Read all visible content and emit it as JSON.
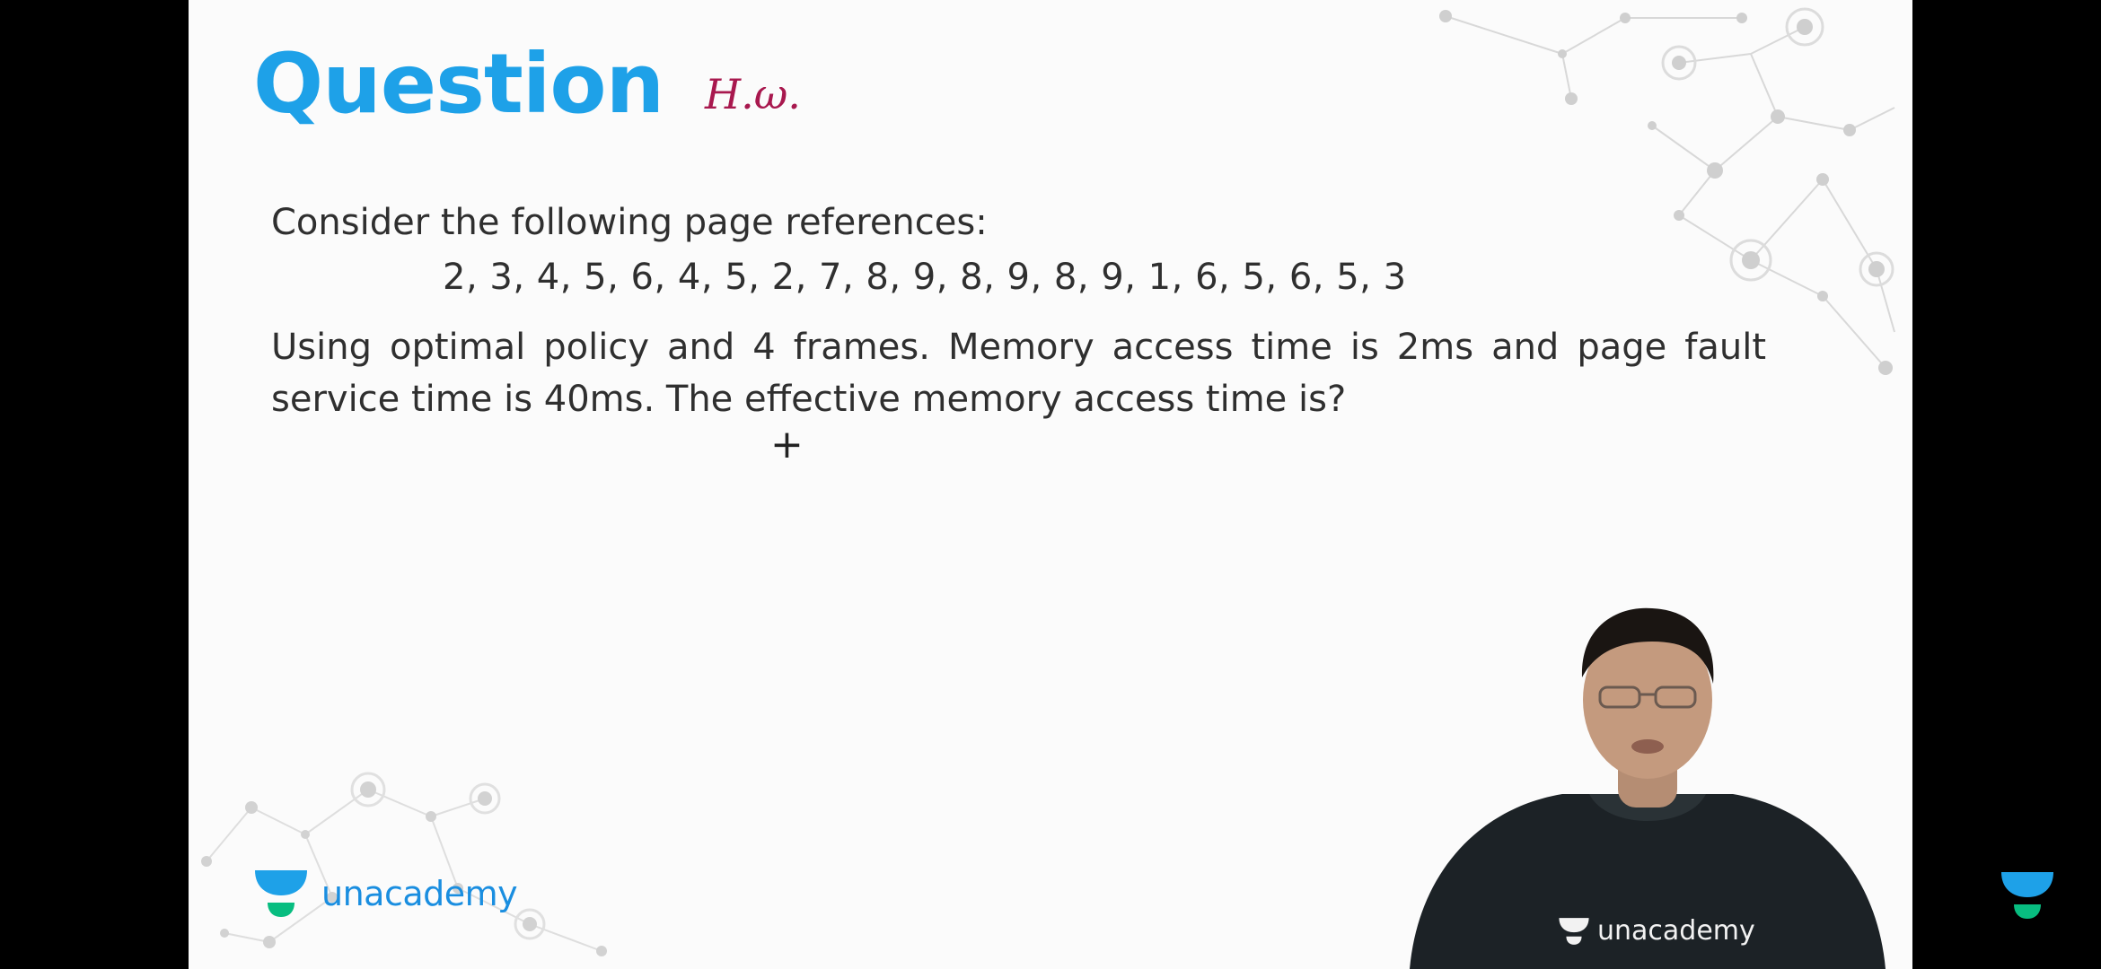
{
  "slide": {
    "title": "Question",
    "annotation": "H.ω.",
    "intro": "Consider the following page references:",
    "references": "2, 3, 4, 5, 6, 4, 5, 2, 7, 8, 9, 8, 9, 8, 9, 1, 6, 5, 6, 5, 3",
    "body": "Using optimal policy and 4 frames. Memory access time is 2ms and page fault service time is 40ms. The effective memory access time is?",
    "cursor": "+"
  },
  "branding": {
    "logo_text": "unacademy",
    "shirt_logo_text": "unacademy",
    "brand_blue": "#1ea1e8",
    "brand_green": "#08bd80"
  },
  "icons": {
    "slide_logo": "unacademy-logo-icon",
    "corner_logo": "unacademy-logo-icon",
    "shirt_logo": "unacademy-logo-icon"
  }
}
